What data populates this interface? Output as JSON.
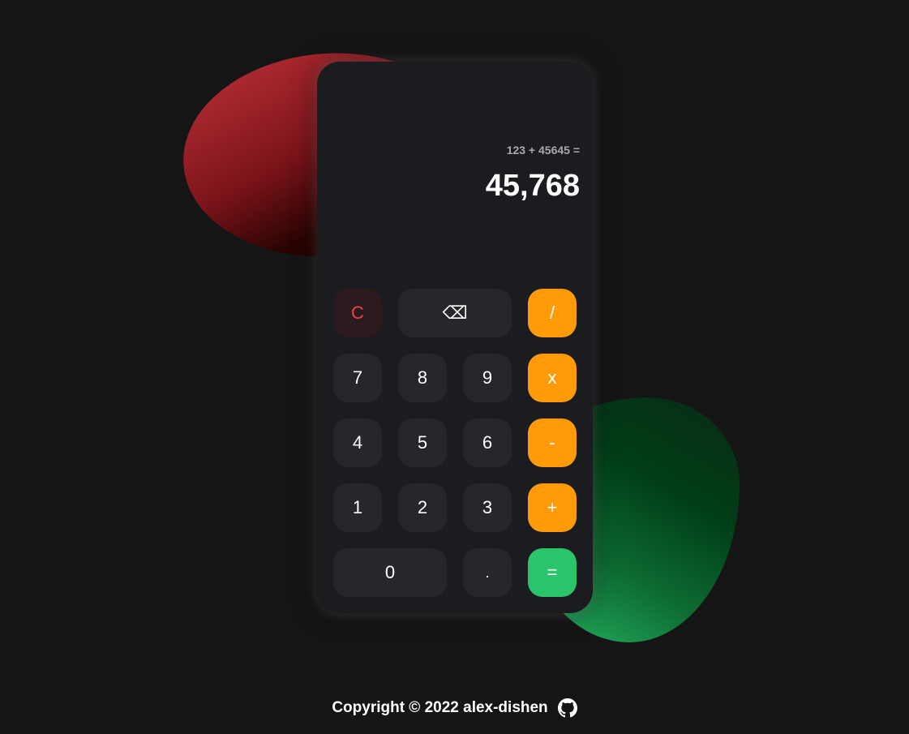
{
  "calculator": {
    "expression": "123 + 45645 =",
    "result": "45,768"
  },
  "keys": {
    "clear": "C",
    "backspace": "⌫",
    "divide": "/",
    "seven": "7",
    "eight": "8",
    "nine": "9",
    "multiply": "x",
    "four": "4",
    "five": "5",
    "six": "6",
    "subtract": "-",
    "one": "1",
    "two": "2",
    "three": "3",
    "add": "+",
    "zero": "0",
    "decimal": ".",
    "equals": "="
  },
  "footer": {
    "copyright": "Copyright © 2022 alex-dishen",
    "icon": "github-icon"
  },
  "colors": {
    "operator": "#ff9a08",
    "equals": "#2ac56b",
    "clear": "#e8434c"
  }
}
